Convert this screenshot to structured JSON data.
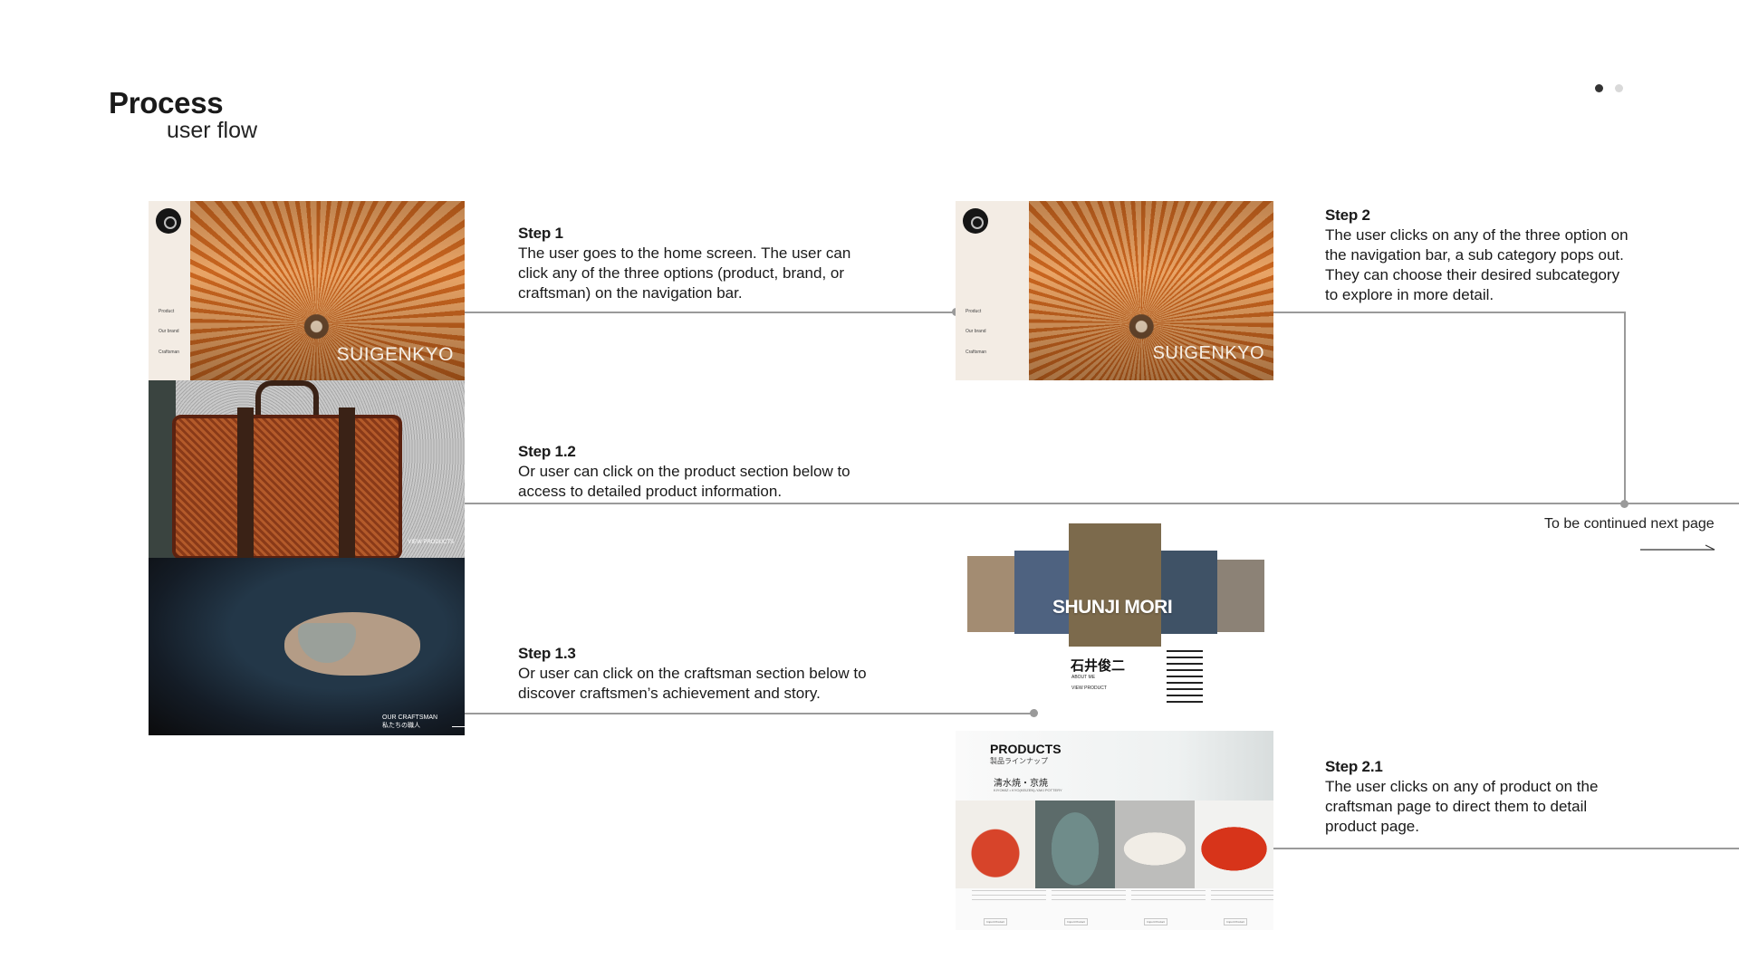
{
  "header": {
    "title": "Process",
    "subtitle": "user flow"
  },
  "pager": {
    "count": 2,
    "active": 0,
    "colors": {
      "active": "#333333",
      "inactive": "#d9d9d9"
    }
  },
  "steps": {
    "s1": {
      "title": "Step 1",
      "body": "The user goes to the home screen. The user can click any of the three options (product, brand, or craftsman) on the navigation bar."
    },
    "s12": {
      "title": "Step 1.2",
      "body": "Or user can click on the product section below to access to detailed product information."
    },
    "s13": {
      "title": "Step 1.3",
      "body": "Or user can click on the craftsman section below to discover craftsmen’s achievement and story."
    },
    "s2": {
      "title": "Step 2",
      "body": "The user clicks on any of the three option on the navigation bar, a sub category pops out. They can choose their desired subcategory to explore in more detail."
    },
    "s21": {
      "title": "Step 2.1",
      "body": "The user clicks on any of product on the craftsman page to direct them to detail product page."
    }
  },
  "continue_note": "To be continued next page",
  "screens": {
    "home": {
      "brand": "SUIGENKYO",
      "nav": [
        "Product",
        "Our brand",
        "Craftsman"
      ]
    },
    "home2": {
      "brand": "SUIGENKYO",
      "nav": [
        "Product",
        "Our brand",
        "Craftsman"
      ]
    },
    "bag": {
      "label": "VIEW PRODUCTS"
    },
    "craft": {
      "label1": "OUR CRAFTSMAN",
      "label2": "私たちの職人"
    },
    "craftsman_page": {
      "name": "SHUNJI MORI",
      "kanji": "石井俊二",
      "about": "ABOUT ME",
      "view": "VIEW PRODUCT"
    },
    "products": {
      "title": "PRODUCTS",
      "subtitle": "製品ラインナップ",
      "category": "清水焼・京焼",
      "category_en": "KIYOMIZ • KYO(KEIZEN)-YAKI POTTERY",
      "button": "Import Product"
    }
  }
}
